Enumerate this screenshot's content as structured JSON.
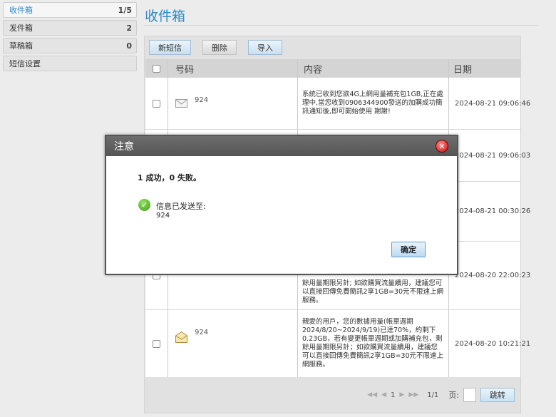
{
  "sidebar": {
    "items": [
      {
        "label": "收件箱",
        "count": "1/5"
      },
      {
        "label": "发件箱",
        "count": "2"
      },
      {
        "label": "草稿箱",
        "count": "0"
      },
      {
        "label": "短信设置",
        "count": ""
      }
    ]
  },
  "page": {
    "title": "收件箱"
  },
  "toolbar": {
    "new_label": "新短信",
    "delete_label": "删除",
    "import_label": "导入"
  },
  "table": {
    "headers": {
      "number": "号码",
      "content": "内容",
      "date": "日期"
    },
    "rows": [
      {
        "number": "924",
        "content": "系統已收到您欲4G上網用量補充包1GB,正在處理中,當您收到0906344900發送的加購成功簡訊通知後,即可開始使用 謝謝!",
        "date": "2024-08-21 09:06:46"
      },
      {
        "number": "",
        "content": "",
        "date": "2024-08-21 09:06:03"
      },
      {
        "number": "",
        "content": "",
        "date": "2024-08-21 00:30:26"
      },
      {
        "number": "",
        "content": "餘用量期限另計; 如欲購買流量續用，建議您可以直接回傳免費簡訊2享1GB=30元不限速上網服務。",
        "date": "2024-08-20 22:00:23"
      },
      {
        "number": "924",
        "content": "親愛的用戶，您的數據用量(帳單週期2024/8/20~2024/9/19)已達70%，約剩下0.23GB，若有變更帳單週期或加購補充包，剩餘用量期限另計；如欲購買流量續用，建議您可以直接回傳免費簡訊2享1GB=30元不限速上網服務。",
        "date": "2024-08-20 10:21:21"
      }
    ]
  },
  "pager": {
    "current": "1",
    "total": "1/1",
    "page_label": "页:",
    "jump_label": "跳转"
  },
  "modal": {
    "title": "注意",
    "summary": "1 成功，0 失败。",
    "sent_label": "信息已发送至:",
    "sent_number": "924",
    "ok_label": "确定"
  },
  "colors": {
    "accent": "#2f8bc9",
    "modal_header": "#5f5f5f",
    "close": "#d01818",
    "success": "#4aa51d"
  }
}
